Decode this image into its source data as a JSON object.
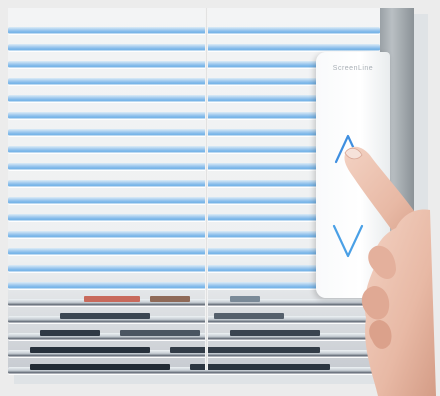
{
  "control_panel": {
    "brand": "ScreenLine",
    "buttons": [
      {
        "name": "raise",
        "icon": "chevron-up-icon"
      },
      {
        "name": "lower",
        "icon": "chevron-down-icon"
      }
    ]
  },
  "colors": {
    "slat_blue": "#6fb0e6",
    "chevron_blue": "#3f8fe0",
    "background": "#ececec"
  }
}
